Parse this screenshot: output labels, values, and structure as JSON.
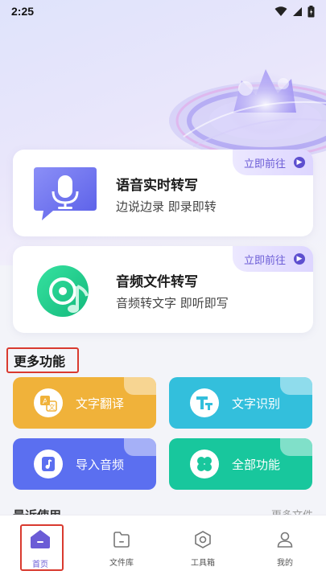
{
  "status_bar": {
    "time": "2:25"
  },
  "cards": [
    {
      "title": "语音实时转写",
      "subtitle": "边说边录  即录即转",
      "go_label": "立即前往",
      "icon": "microphone-chat-icon"
    },
    {
      "title": "音频文件转写",
      "subtitle": "音频转文字  即听即写",
      "go_label": "立即前往",
      "icon": "vinyl-music-note-icon"
    }
  ],
  "more_features": {
    "title": "更多功能",
    "items": [
      {
        "label": "文字翻译",
        "icon": "translate-icon",
        "color": "#f0b23a"
      },
      {
        "label": "文字识别",
        "icon": "text-recognition-icon",
        "color": "#33bfdc"
      },
      {
        "label": "导入音频",
        "icon": "music-note-icon",
        "color": "#5b6ff0"
      },
      {
        "label": "全部功能",
        "icon": "clover-grid-icon",
        "color": "#18c79d"
      }
    ]
  },
  "recent": {
    "title": "最近使用",
    "more_label": "更多文件"
  },
  "tabbar": {
    "items": [
      {
        "label": "首页",
        "icon": "home-icon",
        "active": true
      },
      {
        "label": "文件库",
        "icon": "folder-icon",
        "active": false
      },
      {
        "label": "工具箱",
        "icon": "toolbox-hexagon-icon",
        "active": false
      },
      {
        "label": "我的",
        "icon": "person-icon",
        "active": false
      }
    ]
  },
  "colors": {
    "accent": "#6b5cd6",
    "highlight_box": "#d93a2f"
  }
}
